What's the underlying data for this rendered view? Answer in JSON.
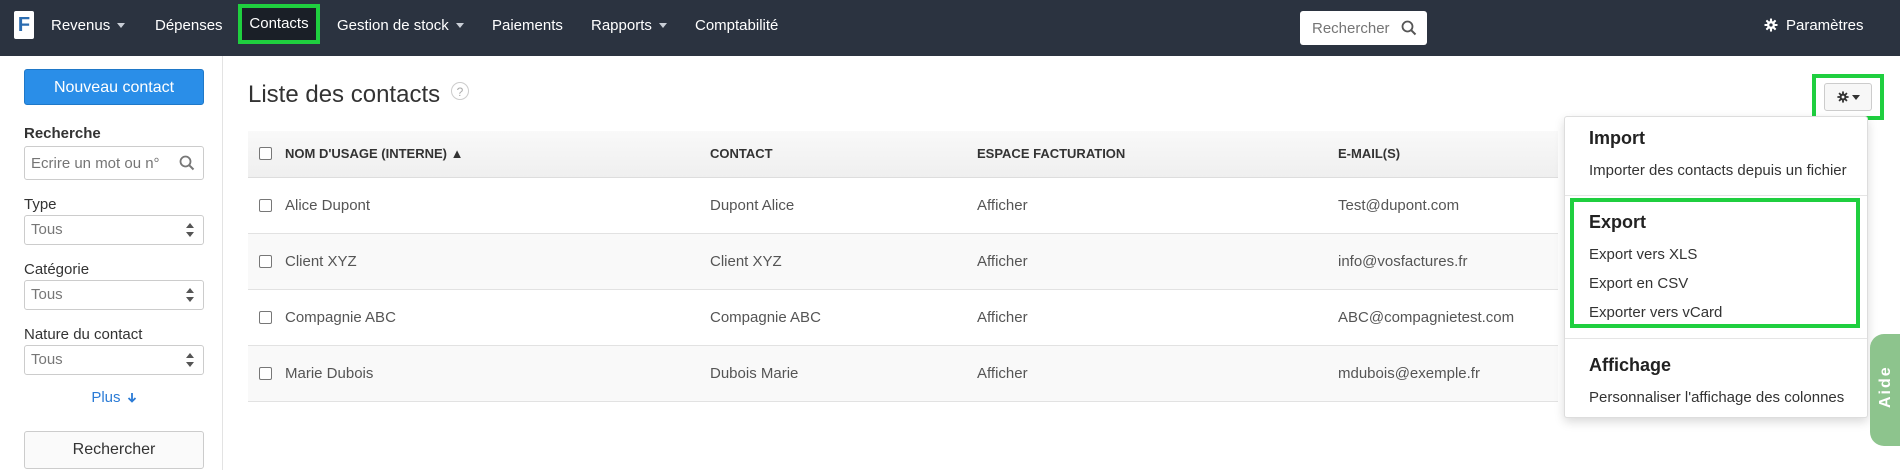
{
  "nav": {
    "logo": "F",
    "items": [
      {
        "label": "Revenus",
        "dropdown": true
      },
      {
        "label": "Dépenses",
        "dropdown": false
      },
      {
        "label": "Contacts",
        "dropdown": false,
        "active": true
      },
      {
        "label": "Gestion de stock",
        "dropdown": true
      },
      {
        "label": "Paiements",
        "dropdown": false
      },
      {
        "label": "Rapports",
        "dropdown": true
      },
      {
        "label": "Comptabilité",
        "dropdown": false
      }
    ],
    "search_placeholder": "Rechercher",
    "settings_label": "Paramètres"
  },
  "sidebar": {
    "new_contact": "Nouveau contact",
    "search_label": "Recherche",
    "search_placeholder": "Ecrire un mot ou n°",
    "type_label": "Type",
    "type_value": "Tous",
    "category_label": "Catégorie",
    "category_value": "Tous",
    "nature_label": "Nature du contact",
    "nature_value": "Tous",
    "more_link": "Plus",
    "search_button": "Rechercher"
  },
  "main": {
    "title": "Liste des contacts",
    "help": "?",
    "columns": [
      "NOM D'USAGE (INTERNE) ▲",
      "CONTACT",
      "ESPACE FACTURATION",
      "E-MAIL(S)"
    ],
    "rows": [
      {
        "name": "Alice Dupont",
        "contact": "Dupont Alice",
        "billing": "Afficher",
        "email": "Test@dupont.com"
      },
      {
        "name": "Client XYZ",
        "contact": "Client XYZ",
        "billing": "Afficher",
        "email": "info@vosfactures.fr"
      },
      {
        "name": "Compagnie ABC",
        "contact": "Compagnie ABC",
        "billing": "Afficher",
        "email": "ABC@compagnietest.com"
      },
      {
        "name": "Marie Dubois",
        "contact": "Dubois Marie",
        "billing": "Afficher",
        "email": "mdubois@exemple.fr"
      }
    ]
  },
  "dropdown": {
    "import_header": "Import",
    "import_item": "Importer des contacts depuis un fichier",
    "export_header": "Export",
    "export_items": [
      "Export vers XLS",
      "Export en CSV",
      "Exporter vers vCard"
    ],
    "display_header": "Affichage",
    "display_item": "Personnaliser l'affichage des colonnes"
  },
  "help_tab": "Aide",
  "icons": {
    "search": "search-icon",
    "gear": "gear-icon",
    "caret": "caret-down-icon",
    "arrow": "arrow-down-icon"
  },
  "colors": {
    "navbar": "#2b3340",
    "primary": "#2a8ee8",
    "highlight": "#1fcf3f",
    "link": "#2a7bd6",
    "help_tab": "#8dc48d"
  }
}
